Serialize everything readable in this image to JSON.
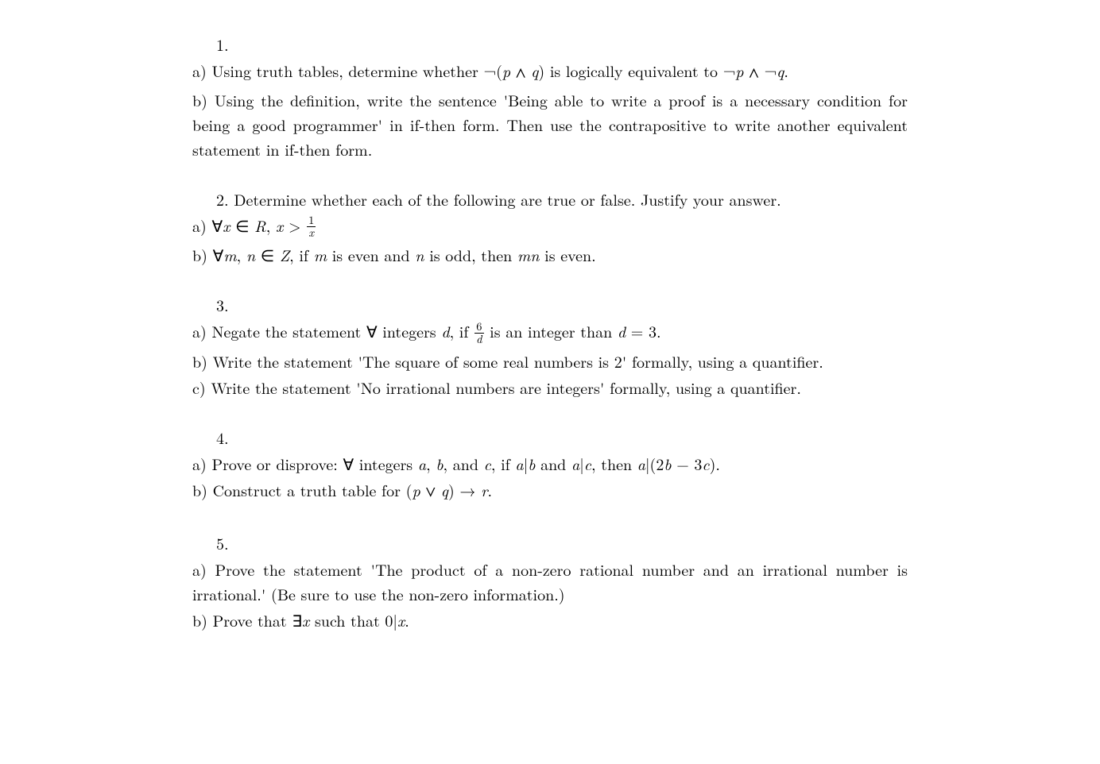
{
  "problems": [
    {
      "number": "1.",
      "parts": [
        {
          "letter": "a)",
          "html": "Using truth tables, determine whether ¬(<span class='math-i'>p</span> <span class='sym'>∧</span> <span class='math-i'>q</span>) is logically equivalent to ¬<span class='math-i'>p</span> <span class='sym'>∧</span> ¬<span class='math-i'>q</span>."
        },
        {
          "letter": "b)",
          "html": "Using the definition, write the sentence 'Being able to write a proof is a necessary condition for being a good programmer' in if-then form. Then use the contrapositive to write another equivalent statement in if-then form."
        }
      ]
    },
    {
      "number": "2.",
      "intro": "Determine whether each of the following are true or false. Justify your answer.",
      "parts": [
        {
          "letter": "a)",
          "html": "∀<span class='math-i'>x</span> ∈ <span class='math-i'>R</span>, <span class='math-i'>x</span> &gt; <span class='frac'><span class='top'>1</span><span class='bot math-i'>x</span></span>"
        },
        {
          "letter": "b)",
          "html": "∀<span class='math-i'>m</span>, <span class='math-i'>n</span> ∈ <span class='math-i'>Z</span>, if <span class='math-i'>m</span> is even and <span class='math-i'>n</span> is odd, then <span class='math-i'>mn</span> is even."
        }
      ]
    },
    {
      "number": "3.",
      "parts": [
        {
          "letter": "a)",
          "html": "Negate the statement ∀ integers <span class='math-i'>d</span>, if <span class='frac'><span class='top'>6</span><span class='bot math-i'>d</span></span> is an integer than <span class='math-i'>d</span> = 3."
        },
        {
          "letter": "b)",
          "html": "Write the statement 'The square of some real numbers is 2' formally, using a quantifier."
        },
        {
          "letter": "c)",
          "html": "Write the statement 'No irrational numbers are integers' formally, using a quantifier."
        }
      ]
    },
    {
      "number": "4.",
      "parts": [
        {
          "letter": "a)",
          "html": "Prove or disprove: ∀ integers <span class='math-i'>a</span>, <span class='math-i'>b</span>, and <span class='math-i'>c</span>, if <span class='math-i'>a</span>|<span class='math-i'>b</span> and <span class='math-i'>a</span>|<span class='math-i'>c</span>, then <span class='math-i'>a</span>|(2<span class='math-i'>b</span> − 3<span class='math-i'>c</span>)."
        },
        {
          "letter": "b)",
          "html": "Construct a truth table for (<span class='math-i'>p</span> <span class='sym'>∨</span> <span class='math-i'>q</span>) → <span class='math-i'>r</span>."
        }
      ]
    },
    {
      "number": "5.",
      "parts": [
        {
          "letter": "a)",
          "html": "Prove the statement 'The product of a non-zero rational number and an irrational number is irrational.' (Be sure to use the non-zero information.)"
        },
        {
          "letter": "b)",
          "html": "Prove that ∃<span class='math-i'>x</span> such that 0|<span class='math-i'>x</span>."
        }
      ]
    }
  ]
}
